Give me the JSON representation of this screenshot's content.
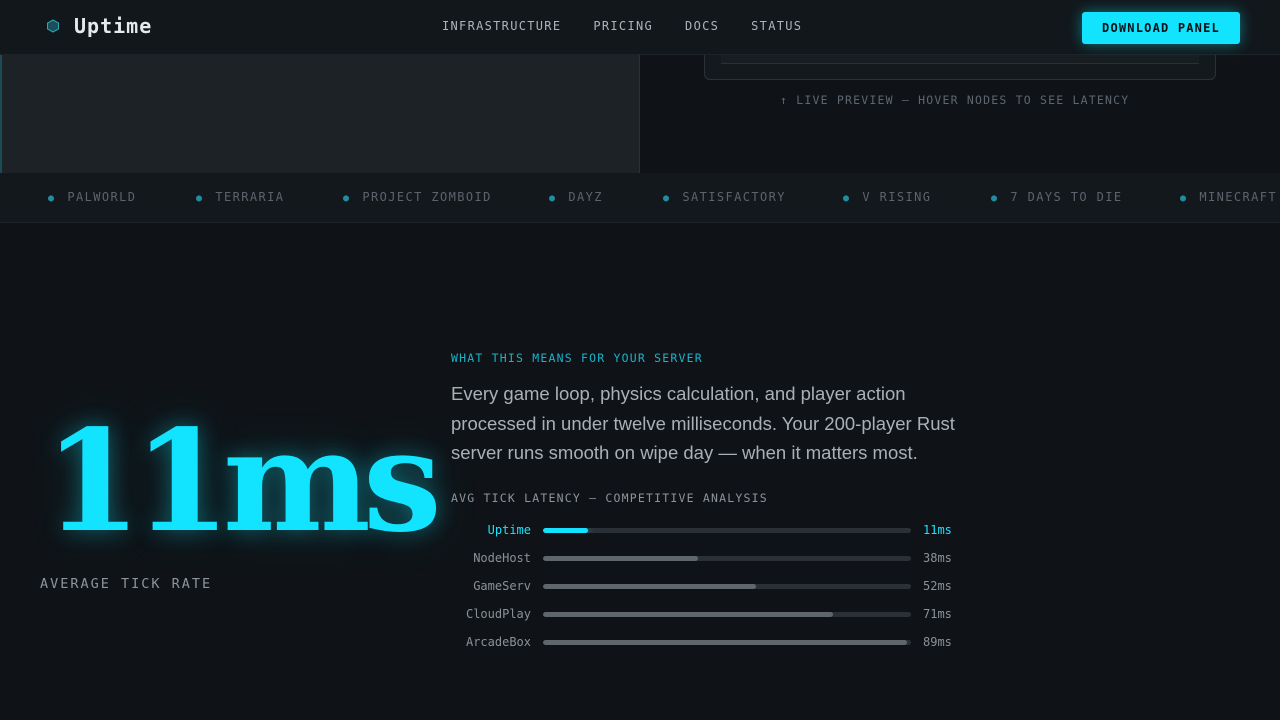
{
  "header": {
    "logo_text": "Uptime",
    "nav": [
      "INFRASTRUCTURE",
      "PRICING",
      "DOCS",
      "STATUS"
    ],
    "cta_label": "DOWNLOAD PANEL"
  },
  "hero": {
    "preview_caption": "↑ LIVE PREVIEW — HOVER NODES TO SEE LATENCY"
  },
  "ticker": {
    "games": [
      "PALWORLD",
      "TERRARIA",
      "PROJECT ZOMBOID",
      "DAYZ",
      "SATISFACTORY",
      "V RISING",
      "7 DAYS TO DIE",
      "MINECRAFT"
    ]
  },
  "stat": {
    "number": "11ms",
    "label": "AVERAGE TICK RATE"
  },
  "details": {
    "eyebrow": "WHAT THIS MEANS FOR YOUR SERVER",
    "body": "Every game loop, physics calculation, and player action processed in under twelve milliseconds. Your 200-player Rust server runs smooth on wipe day — when it matters most.",
    "chart_title": "AVG TICK LATENCY — COMPETITIVE ANALYSIS"
  },
  "latency": {
    "max": 90,
    "rows": [
      {
        "name": "Uptime",
        "value": 11,
        "label": "11ms",
        "highlight": true
      },
      {
        "name": "NodeHost",
        "value": 38,
        "label": "38ms",
        "highlight": false
      },
      {
        "name": "GameServ",
        "value": 52,
        "label": "52ms",
        "highlight": false
      },
      {
        "name": "CloudPlay",
        "value": 71,
        "label": "71ms",
        "highlight": false
      },
      {
        "name": "ArcadeBox",
        "value": 89,
        "label": "89ms",
        "highlight": false
      }
    ]
  },
  "colors": {
    "accent": "#12e4ff",
    "background": "#0f1317"
  }
}
